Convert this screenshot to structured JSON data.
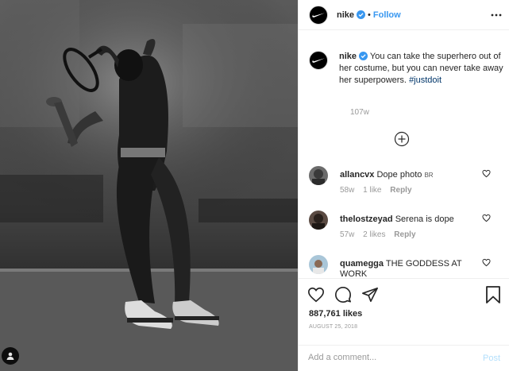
{
  "post": {
    "username": "nike",
    "dot": "•",
    "follow_label": "Follow",
    "caption_text": "You can take the superhero out of her costume, but you can never take away her superpowers.",
    "hashtag": "#justdoit",
    "caption_time": "107w"
  },
  "comments": [
    {
      "username": "allancvx",
      "text": "Dope photo",
      "flag": "BR",
      "time": "58w",
      "likes": "1 like",
      "reply": "Reply"
    },
    {
      "username": "thelostzeyad",
      "text": "Serena is dope",
      "time": "57w",
      "likes": "2 likes",
      "reply": "Reply"
    },
    {
      "username": "quamegga",
      "text": "THE GODDESS AT WORK"
    }
  ],
  "footer": {
    "likes": "887,761 likes",
    "date": "AUGUST 25, 2018",
    "comment_placeholder": "Add a comment...",
    "post_label": "Post"
  },
  "colors": {
    "link_blue": "#3897f0",
    "post_disabled": "#b2dffc",
    "muted": "#999999",
    "hashtag": "#003569"
  },
  "icons": [
    "nike-swoosh-icon",
    "verified-badge-icon",
    "more-options-icon",
    "load-more-plus-icon",
    "heart-icon",
    "comment-icon",
    "share-icon",
    "bookmark-icon",
    "user-tag-icon"
  ]
}
